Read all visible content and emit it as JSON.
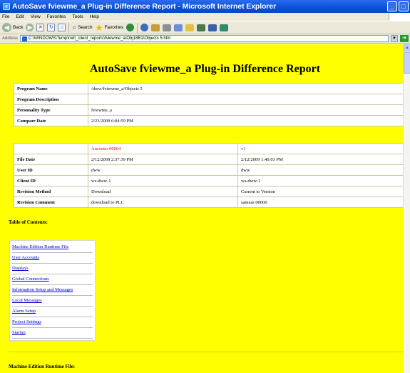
{
  "window": {
    "title": "AutoSave fviewme_a Plug-in Difference Report - Microsoft Internet Explorer",
    "minimize_glyph": "_",
    "maximize_glyph": "□"
  },
  "menu": [
    "File",
    "Edit",
    "View",
    "Favorites",
    "Tools",
    "Help"
  ],
  "toolbar": {
    "back_label": "Back",
    "search_label": "Search",
    "favorites_label": "Favorites"
  },
  "address": {
    "label": "Address",
    "value": "C:\\WINDOWS\\Temp\\mdt_client_reports\\fviewme_a\\Obj18B1\\Objects 5.htm"
  },
  "report": {
    "title": "AutoSave fviewme_a Plug-in Difference Report",
    "program_info": [
      {
        "key": "Program Name",
        "value": "/dww/fviewme_a/Objects 5"
      },
      {
        "key": "Program Description",
        "value": ""
      },
      {
        "key": "Personality Type",
        "value": "fviewme_a"
      },
      {
        "key": "Compare Date",
        "value": "2/23/2009 6:04:59 PM"
      }
    ],
    "compare": {
      "header": {
        "blank": "",
        "ancestor": "Ancestor 00004",
        "current": "v1"
      },
      "rows": [
        {
          "key": "File Date",
          "ancestor": "2/12/2009 2:37:39 PM",
          "current": "2/12/2009 1:40:03 PM"
        },
        {
          "key": "User ID",
          "ancestor": "dww",
          "current": "dww"
        },
        {
          "key": "Client ID",
          "ancestor": "ws-dww-1",
          "current": "ws-dww-1"
        },
        {
          "key": "Revision Method",
          "ancestor": "Download",
          "current": "Current to Version"
        },
        {
          "key": "Revision Comment",
          "ancestor": "download to PLC",
          "current": "sameas 00000"
        }
      ]
    },
    "toc_heading": "Table of Contents:",
    "toc": [
      "Machine Edition Runtime File",
      "User Accounts",
      "Displays",
      "Global Connections",
      "Information Setup and Messages",
      "Local Messages",
      "Alarm Setup",
      "Project Settings",
      "Startup"
    ],
    "section_heading": "Machine Edition Runtime File:"
  },
  "colors": {
    "page_background": "#ffff00",
    "link": "#0000cc",
    "ancestor": "#e00000",
    "current": "#2a2ad0"
  },
  "icons": [
    "ie-app-icon",
    "back-arrow-icon",
    "forward-arrow-icon",
    "stop-icon",
    "refresh-icon",
    "home-icon",
    "search-icon",
    "favorites-star-icon",
    "media-icon",
    "history-icon",
    "mail-icon",
    "print-icon",
    "edit-icon",
    "discuss-icon",
    "messenger-icon",
    "page-icon",
    "go-arrow-icon"
  ]
}
